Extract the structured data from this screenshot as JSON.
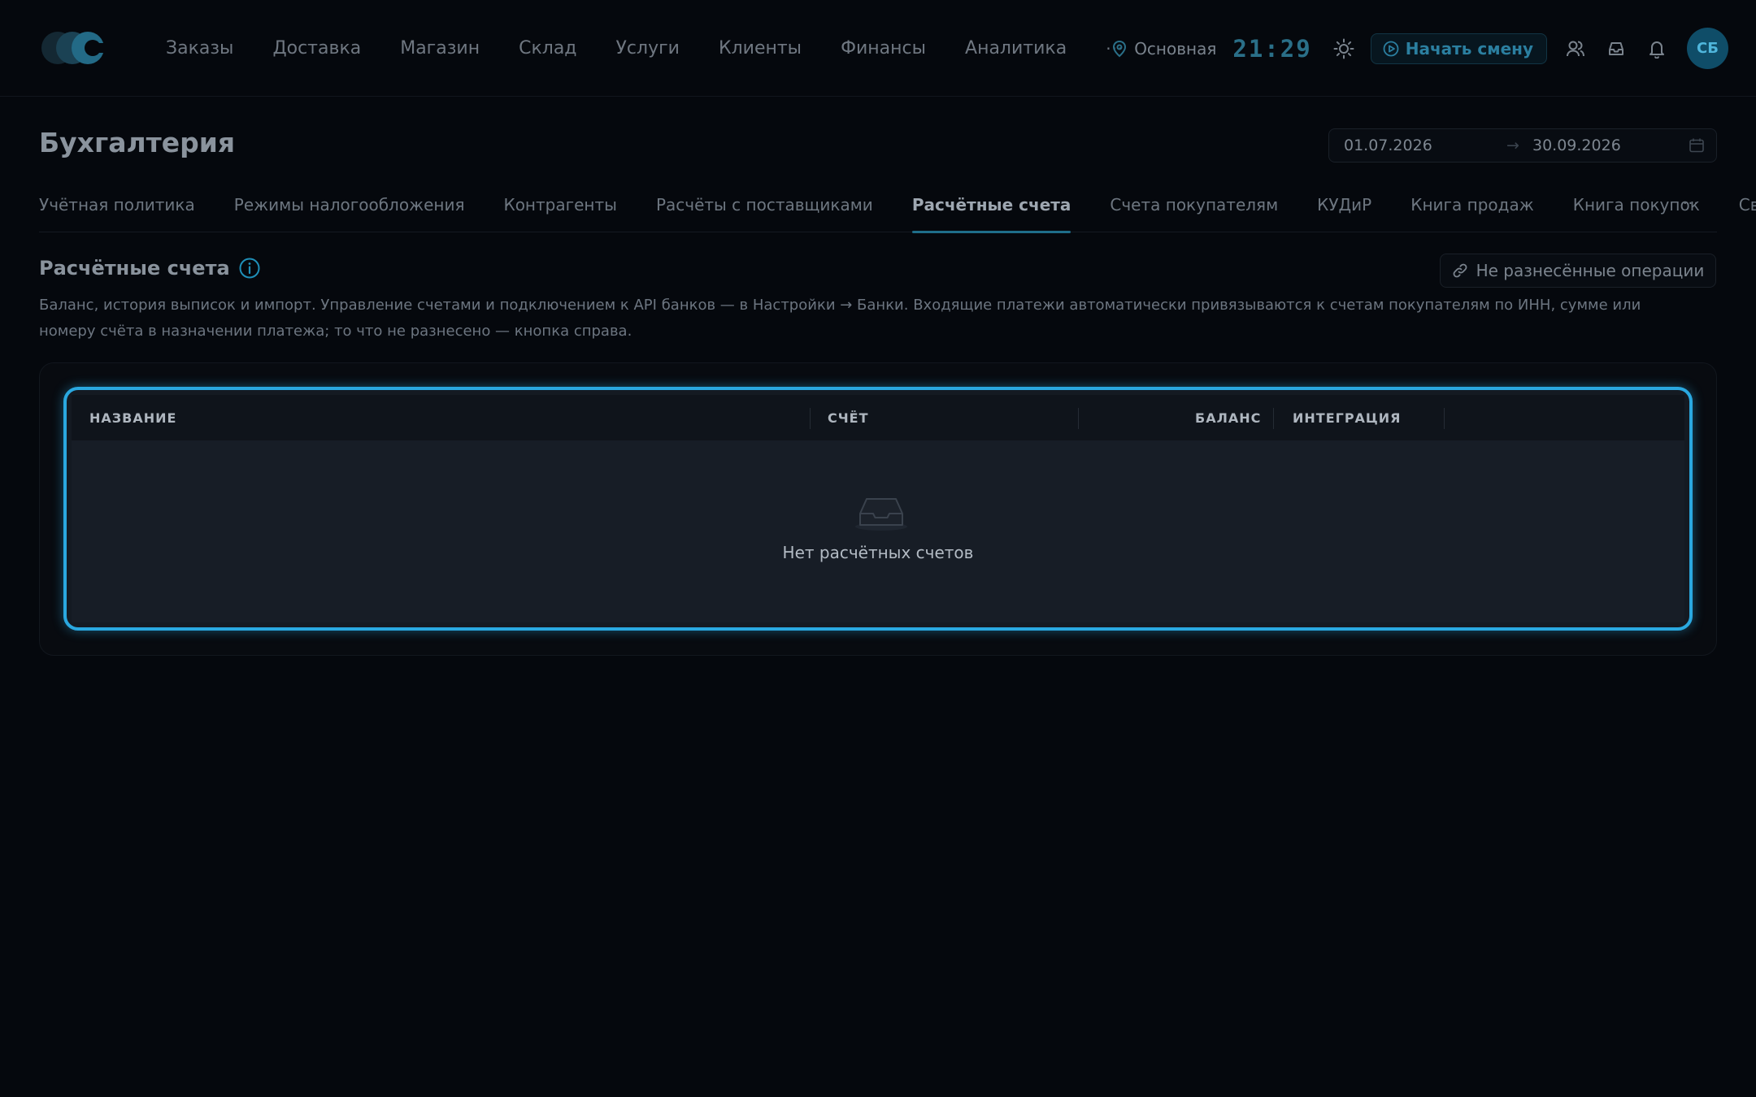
{
  "nav": {
    "items": [
      "Заказы",
      "Доставка",
      "Магазин",
      "Склад",
      "Услуги",
      "Клиенты",
      "Финансы",
      "Аналитика"
    ],
    "more": "···"
  },
  "top": {
    "branch": "Основная",
    "clock": "21:29",
    "shift_button": "Начать смену",
    "avatar": "СБ"
  },
  "page": {
    "title": "Бухгалтерия",
    "date_from": "01.07.2026",
    "date_arrow": "→",
    "date_to": "30.09.2026"
  },
  "tabs": {
    "items": [
      "Учётная политика",
      "Режимы налогообложения",
      "Контрагенты",
      "Расчёты с поставщиками",
      "Расчётные счета",
      "Счета покупателям",
      "КУДиР",
      "Книга продаж",
      "Книга покупок",
      "Свод НД"
    ],
    "active": "Расчётные счета",
    "more": "···"
  },
  "section": {
    "title": "Расчётные счета",
    "unmatched_button": "Не разнесённые операции",
    "description": "Баланс, история выписок и импорт. Управление счетами и подключением к API банков — в Настройки → Банки. Входящие платежи автоматически привязываются к счетам покупателям по ИНН, сумме или номеру счёта в назначении платежа; то что не разнесено — кнопка справа."
  },
  "table": {
    "columns": [
      "НАЗВАНИЕ",
      "СЧЁТ",
      "БАЛАНС",
      "ИНТЕГРАЦИЯ"
    ],
    "rows": [],
    "empty_text": "Нет расчётных счетов"
  },
  "colors": {
    "accent": "#2aa8e0",
    "brand": "#1f6e8a",
    "background": "#05080d"
  },
  "icons": [
    "logo-icon",
    "location-pin-icon",
    "sun-icon",
    "play-circle-icon",
    "users-icon",
    "inbox-icon",
    "bell-icon",
    "calendar-icon",
    "info-icon",
    "link-icon",
    "empty-inbox-icon"
  ]
}
